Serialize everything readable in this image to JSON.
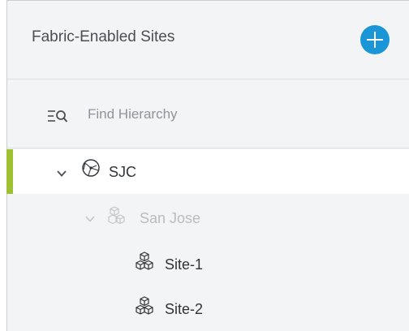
{
  "header": {
    "title": "Fabric-Enabled Sites",
    "add_button_icon": "plus-icon",
    "add_button_color": "#1a96d6"
  },
  "search": {
    "icon": "filter-search-icon",
    "placeholder": "Find Hierarchy",
    "value": ""
  },
  "tree": {
    "accent_color": "#9fc131",
    "nodes": [
      {
        "label": "SJC",
        "icon": "globe-icon",
        "expanded": true,
        "selected": true,
        "level": 0
      },
      {
        "label": "San Jose",
        "icon": "building-cubes-icon",
        "expanded": true,
        "selected": false,
        "disabled": true,
        "level": 1
      },
      {
        "label": "Site-1",
        "icon": "building-cubes-icon",
        "selected": false,
        "level": 2
      },
      {
        "label": "Site-2",
        "icon": "building-cubes-icon",
        "selected": false,
        "level": 2
      }
    ]
  }
}
